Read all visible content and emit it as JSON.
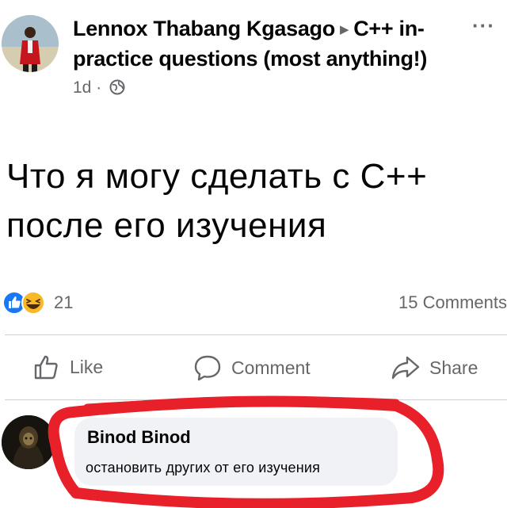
{
  "post": {
    "author": "Lennox Thabang Kgasago",
    "group": "C++ in-practice questions (most anything!)",
    "time": "1d",
    "meta_separator": "·",
    "more_icon": "more-horizontal-icon",
    "text": "Что я могу сделать с C++ после его изучения"
  },
  "stats": {
    "reaction_count": "21",
    "comments_count": "15 Comments",
    "reaction_icons": [
      "like-reaction-icon",
      "haha-reaction-icon"
    ]
  },
  "actions": {
    "like": "Like",
    "comment": "Comment",
    "share": "Share"
  },
  "comment": {
    "author": "Binod Binod",
    "text": "остановить других от его изучения"
  },
  "colors": {
    "facebook_blue": "#1877f2",
    "secondary_text": "#65676b",
    "bubble_bg": "#f0f2f5",
    "highlight_red": "#e8202a"
  }
}
